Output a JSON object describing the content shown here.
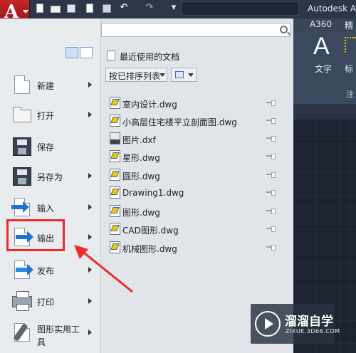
{
  "app": {
    "title": "Autodesk Au",
    "app_button_letter": "A"
  },
  "quick_access": {
    "icons": [
      "new-icon",
      "open-icon",
      "save-icon",
      "saveas-icon",
      "print-icon",
      "undo-icon",
      "redo-icon",
      "dropdown-icon"
    ]
  },
  "ribbon": {
    "tabs": [
      "A360",
      "精选"
    ],
    "text_button_glyph": "A",
    "text_button_label": "文字",
    "dim_button_label": "标",
    "panel_label": "注"
  },
  "menu": {
    "search_placeholder": "",
    "items": [
      {
        "label": "新建",
        "icon": "new-document-icon"
      },
      {
        "label": "打开",
        "icon": "open-folder-icon"
      },
      {
        "label": "保存",
        "icon": "save-disk-icon"
      },
      {
        "label": "另存为",
        "icon": "save-as-icon"
      },
      {
        "label": "输入",
        "icon": "import-icon"
      },
      {
        "label": "输出",
        "icon": "export-icon"
      },
      {
        "label": "发布",
        "icon": "publish-icon"
      },
      {
        "label": "打印",
        "icon": "printer-icon"
      },
      {
        "label": "图形实用工具",
        "label_line1": "图形实用工",
        "label_line2": "具",
        "icon": "wrench-icon"
      }
    ],
    "highlighted_item": "输出",
    "highlight_color": "#ee2b2b"
  },
  "recent": {
    "title": "最近使用的文档",
    "sort_label": "按已排序列表",
    "files": [
      {
        "name": "室内设计.dwg",
        "type": "dwg"
      },
      {
        "name": "小高层住宅楼平立剖面图.dwg",
        "type": "dwg"
      },
      {
        "name": "图片.dxf",
        "type": "dxf"
      },
      {
        "name": "星形.dwg",
        "type": "dwg"
      },
      {
        "name": "圆形.dwg",
        "type": "dwg"
      },
      {
        "name": "Drawing1.dwg",
        "type": "dwg"
      },
      {
        "name": "图形.dwg",
        "type": "dwg"
      },
      {
        "name": "CAD图形.dwg",
        "type": "dwg"
      },
      {
        "name": "机械图形.dwg",
        "type": "dwg"
      }
    ]
  },
  "watermark": {
    "text": "溜溜自学",
    "url": "ZIXUE.3D66.COM"
  }
}
